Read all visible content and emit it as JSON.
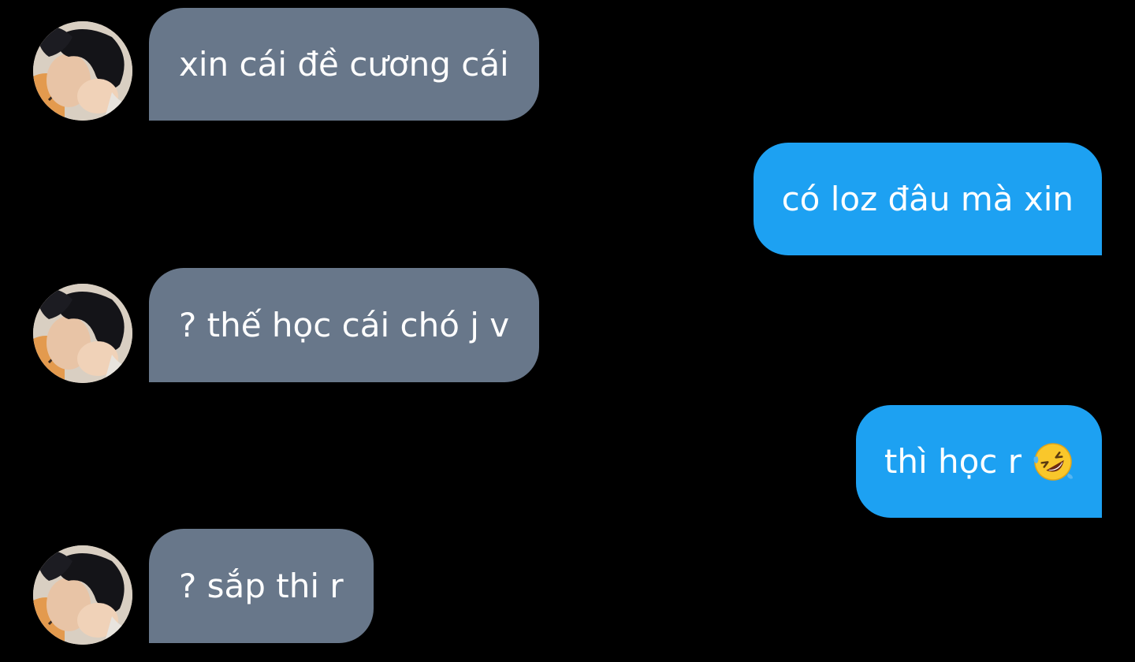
{
  "messages": [
    {
      "sender": "other",
      "text": "xin cái đề cương cái"
    },
    {
      "sender": "me",
      "text": "có loz đâu mà xin"
    },
    {
      "sender": "other",
      "text": "? thế học cái chó j v"
    },
    {
      "sender": "me",
      "text": "thì học r",
      "emoji": "rolling-on-the-floor-laughing"
    },
    {
      "sender": "other",
      "text": "? sắp thi r"
    }
  ],
  "colors": {
    "background": "#000000",
    "incoming_bubble": "#68778a",
    "outgoing_bubble": "#1da1f2",
    "text": "#ffffff"
  }
}
